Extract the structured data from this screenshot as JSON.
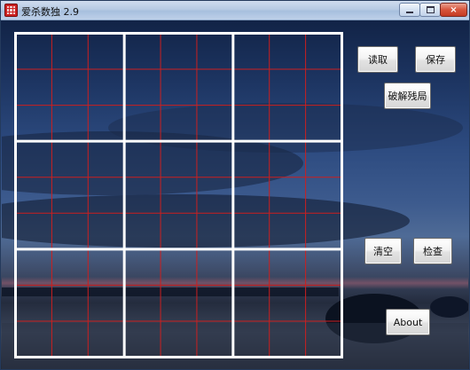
{
  "window": {
    "title": "爱杀数独 2.9",
    "controls": {
      "minimize": "minimize",
      "maximize": "maximize",
      "close": "×"
    }
  },
  "board": {
    "rows": 9,
    "cols": 9,
    "grid_colors": {
      "box_lines": "#ffffff",
      "cell_lines": "#cc1f1f"
    }
  },
  "buttons": {
    "read": "读取",
    "save": "保存",
    "solve": "破解残局",
    "clear": "清空",
    "check": "检查",
    "about": "About"
  },
  "colors": {
    "sky_dark": "#0e1e3e",
    "sky_light": "#4f6b96",
    "sunset": "#c86a7a"
  }
}
